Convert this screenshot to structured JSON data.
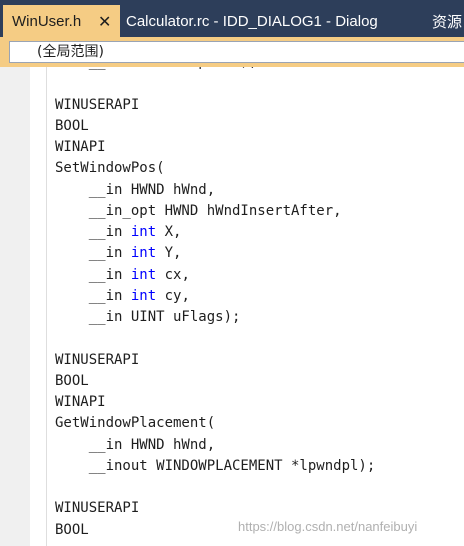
{
  "tabs": [
    {
      "label": "WinUser.h",
      "active": true,
      "close_icon": "close-icon"
    },
    {
      "label": "Calculator.rc - IDD_DIALOG1 - Dialog",
      "active": false
    },
    {
      "label": "资源",
      "active": false
    }
  ],
  "scope": {
    "label": "(全局范围)"
  },
  "code": {
    "lines": [
      [
        {
          "t": "    __in BOOL bRepaint);"
        }
      ],
      [
        {
          "t": ""
        }
      ],
      [
        {
          "t": "WINUSERAPI"
        }
      ],
      [
        {
          "t": "BOOL"
        }
      ],
      [
        {
          "t": "WINAPI"
        }
      ],
      [
        {
          "t": "SetWindowPos("
        }
      ],
      [
        {
          "t": "    __in HWND hWnd,"
        }
      ],
      [
        {
          "t": "    __in_opt HWND hWndInsertAfter,"
        }
      ],
      [
        {
          "t": "    __in "
        },
        {
          "t": "int",
          "kw": true
        },
        {
          "t": " X,"
        }
      ],
      [
        {
          "t": "    __in "
        },
        {
          "t": "int",
          "kw": true
        },
        {
          "t": " Y,"
        }
      ],
      [
        {
          "t": "    __in "
        },
        {
          "t": "int",
          "kw": true
        },
        {
          "t": " cx,"
        }
      ],
      [
        {
          "t": "    __in "
        },
        {
          "t": "int",
          "kw": true
        },
        {
          "t": " cy,"
        }
      ],
      [
        {
          "t": "    __in UINT uFlags);"
        }
      ],
      [
        {
          "t": ""
        }
      ],
      [
        {
          "t": "WINUSERAPI"
        }
      ],
      [
        {
          "t": "BOOL"
        }
      ],
      [
        {
          "t": "WINAPI"
        }
      ],
      [
        {
          "t": "GetWindowPlacement("
        }
      ],
      [
        {
          "t": "    __in HWND hWnd,"
        }
      ],
      [
        {
          "t": "    __inout WINDOWPLACEMENT *lpwndpl);"
        }
      ],
      [
        {
          "t": ""
        }
      ],
      [
        {
          "t": "WINUSERAPI"
        }
      ],
      [
        {
          "t": "BOOL"
        }
      ]
    ]
  },
  "watermark": "https://blog.csdn.net/nanfeibuyi",
  "colors": {
    "tab_strip": "#2d3e5a",
    "active_tab": "#f5cc84",
    "keyword": "#0000ff",
    "text": "#1e1e1e"
  }
}
